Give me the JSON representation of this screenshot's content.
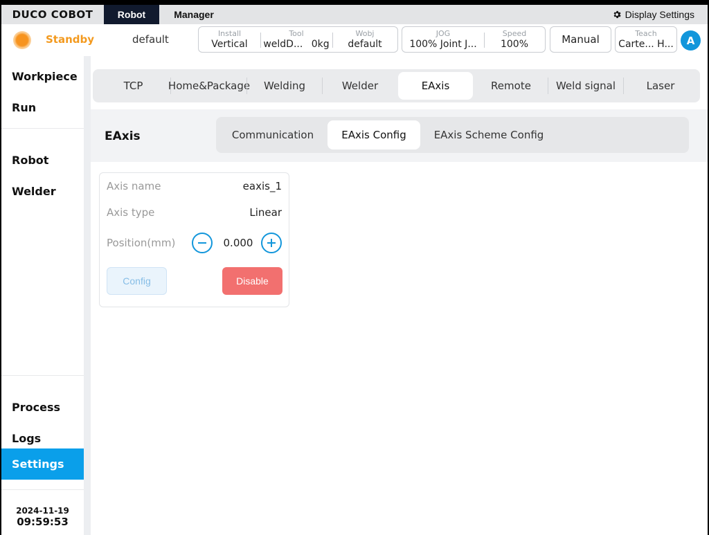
{
  "topbar": {
    "brand": "DUCO COBOT",
    "tabs": [
      {
        "label": "Robot",
        "active": true
      },
      {
        "label": "Manager",
        "active": false
      }
    ],
    "display_settings": "Display Settings",
    "display_settings_icon": "gear-icon"
  },
  "status": {
    "state": "Standby",
    "state_color": "#f39a1f",
    "program": "default",
    "install": {
      "label": "Install",
      "value": "Vertical"
    },
    "tool": {
      "label": "Tool",
      "value": "weldD...",
      "load": "0kg"
    },
    "wobj": {
      "label": "Wobj",
      "value": "default"
    },
    "jog": {
      "label": "JOG",
      "value": "100% Joint J..."
    },
    "speed": {
      "label": "Speed",
      "value": "100%"
    },
    "mode": "Manual",
    "teach": {
      "label": "Teach",
      "value": "Carte... H..."
    },
    "user_initial": "A"
  },
  "sidebar": {
    "items": [
      {
        "label": "Workpiece"
      },
      {
        "label": "Run"
      },
      {
        "label": "Robot"
      },
      {
        "label": "Welder"
      },
      {
        "label": "Process"
      },
      {
        "label": "Logs"
      },
      {
        "label": "Settings",
        "active": true
      }
    ],
    "date": "2024-11-19",
    "time": "09:59:53",
    "accent": "#0a9fea"
  },
  "main": {
    "tabs": [
      {
        "label": "TCP"
      },
      {
        "label": "Home&Package"
      },
      {
        "label": "Welding"
      },
      {
        "label": "Welder"
      },
      {
        "label": "EAxis",
        "active": true
      },
      {
        "label": "Remote"
      },
      {
        "label": "Weld signal"
      },
      {
        "label": "Laser"
      }
    ],
    "section_title": "EAxis",
    "subtabs": [
      {
        "label": "Communication"
      },
      {
        "label": "EAxis Config",
        "active": true
      },
      {
        "label": "EAxis Scheme Config"
      }
    ],
    "card": {
      "axis_name_label": "Axis name",
      "axis_name_value": "eaxis_1",
      "axis_type_label": "Axis type",
      "axis_type_value": "Linear",
      "position_label": "Position(mm)",
      "position_value": "0.000",
      "config_label": "Config",
      "disable_label": "Disable",
      "disable_color": "#f2706f"
    }
  }
}
